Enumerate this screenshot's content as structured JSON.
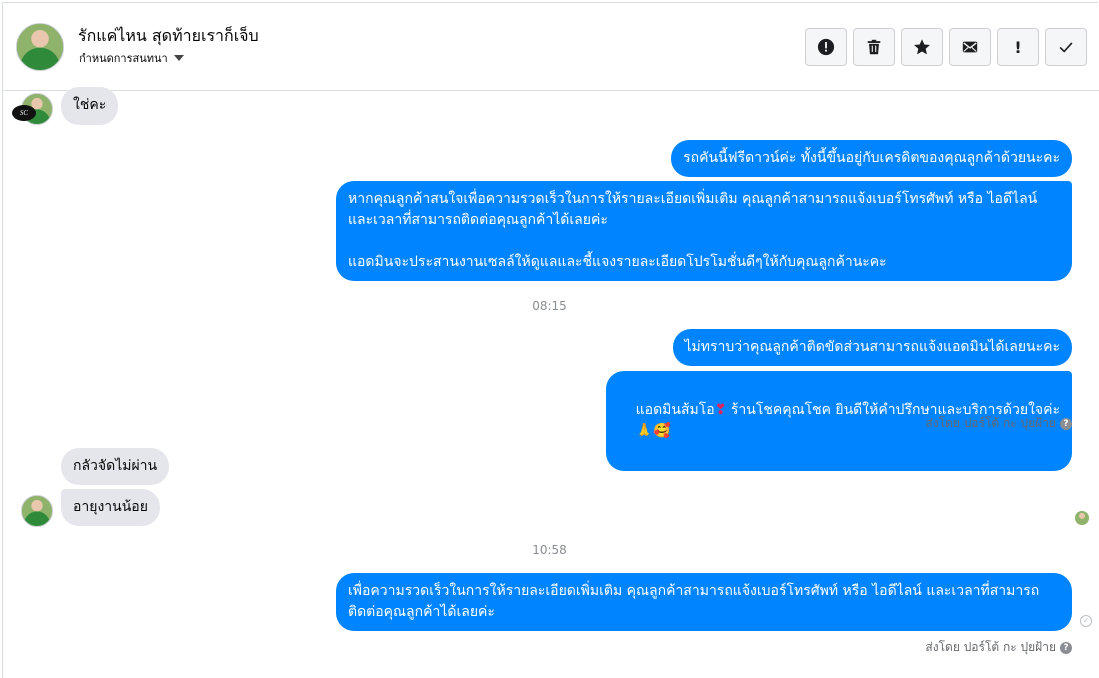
{
  "header": {
    "contact_name": "รักแค่ไหน สุดท้ายเราก็เจ็บ",
    "subtitle": "กำหนดการสนทนา"
  },
  "actions": [
    {
      "name": "report-button",
      "icon": "alert-circle-icon"
    },
    {
      "name": "delete-button",
      "icon": "trash-icon"
    },
    {
      "name": "star-button",
      "icon": "star-icon"
    },
    {
      "name": "mark-unread-button",
      "icon": "envelope-icon"
    },
    {
      "name": "important-button",
      "icon": "exclamation-icon",
      "label": "!"
    },
    {
      "name": "done-button",
      "icon": "check-icon"
    }
  ],
  "messages": {
    "m1": "ใช่คะ",
    "m2": "รถคันนี้ฟรีดาวน์ค่ะ ทั้งนี้ขึ้นอยู่กับเครดิตของคุณลูกค้าด้วยนะคะ",
    "m3": "หากคุณลูกค้าสนใจเพื่อความรวดเร็วในการให้รายละเอียดเพิ่มเติม คุณลูกค้าสามารถแจ้งเบอร์โทรศัพท์ หรือ ไอดีไลน์ และเวลาที่สามารถติดต่อคุณลูกค้าได้เลยค่ะ\n\nแอดมินจะประสานงานเซลล์ให้ดูแลและชี้แจงรายละเอียดโปรโมชั่นดีๆให้กับคุณลูกค้านะคะ",
    "ts1": "08:15",
    "m4": "ไม่ทราบว่าคุณลูกค้าติดขัดส่วนสามารถแจ้งแอดมินได้เลยนะคะ",
    "m5_pre": "แอดมินส้มโอ",
    "m5_heart": "❣",
    "m5_mid": " ร้านโชคคุณโชค ยินดีให้คำปรึกษาและบริการด้วยใจค่ะ",
    "m5_emoji": "🙏🥰",
    "sent_by_1": "ส่งโดย ปอร์โต้ กะ ปุยฝ้าย",
    "m6": "กลัวจัดไม่ผ่าน",
    "m7": "อายุงานน้อย",
    "ts2": "10:58",
    "m8": "เพื่อความรวดเร็วในการให้รายละเอียดเพิ่มเติม คุณลูกค้าสามารถแจ้งเบอร์โทรศัพท์ หรือ ไอดีไลน์ และเวลาที่สามารถติดต่อคุณลูกค้าได้เลยค่ะ",
    "sent_by_2": "ส่งโดย ปอร์โต้ กะ ปุยฝ้าย"
  },
  "colors": {
    "outgoing_bubble": "#0084ff",
    "incoming_bubble": "#e4e6eb"
  }
}
